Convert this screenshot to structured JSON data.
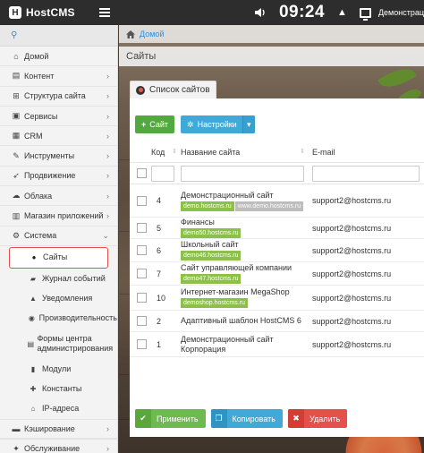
{
  "topbar": {
    "logo_mark": "H",
    "logo_text": "HostCMS",
    "clock": "09:24",
    "user_name": "Демонстрац"
  },
  "sidebar": {
    "items": [
      {
        "label": "Домой",
        "icon": "home-icon",
        "glyph": "⌂",
        "chevron": false
      },
      {
        "label": "Контент",
        "icon": "list-icon",
        "glyph": "▤",
        "chevron": true
      },
      {
        "label": "Структура сайта",
        "icon": "sitemap-icon",
        "glyph": "⊞",
        "chevron": true
      },
      {
        "label": "Сервисы",
        "icon": "briefcase-icon",
        "glyph": "▣",
        "chevron": true
      },
      {
        "label": "CRM",
        "icon": "crm-icon",
        "glyph": "▦",
        "chevron": true
      },
      {
        "label": "Инструменты",
        "icon": "tools-icon",
        "glyph": "✎",
        "chevron": true
      },
      {
        "label": "Продвижение",
        "icon": "rocket-icon",
        "glyph": "➶",
        "chevron": true
      },
      {
        "label": "Облака",
        "icon": "cloud-icon",
        "glyph": "☁",
        "chevron": true
      },
      {
        "label": "Магазин приложений",
        "icon": "store-icon",
        "glyph": "▥",
        "chevron": true
      },
      {
        "label": "Система",
        "icon": "gear-icon",
        "glyph": "⚙",
        "chevron": "down"
      }
    ],
    "sub_items": [
      {
        "label": "Сайты",
        "icon": "globe-icon",
        "glyph": "●",
        "active": true
      },
      {
        "label": "Журнал событий",
        "icon": "book-icon",
        "glyph": "▰"
      },
      {
        "label": "Уведомления",
        "icon": "bell-icon",
        "glyph": "▲"
      },
      {
        "label": "Производительность",
        "icon": "dashboard-icon",
        "glyph": "◉"
      },
      {
        "label": "Формы центра администрирования",
        "icon": "form-icon",
        "glyph": "▤",
        "tall": true
      },
      {
        "label": "Модули",
        "icon": "cube-icon",
        "glyph": "▮"
      },
      {
        "label": "Константы",
        "icon": "puzzle-icon",
        "glyph": "✚"
      },
      {
        "label": "IP-адреса",
        "icon": "ip-icon",
        "glyph": "⌂"
      }
    ],
    "bottom_items": [
      {
        "label": "Кэширование",
        "icon": "database-icon",
        "glyph": "▬",
        "chevron": true
      },
      {
        "label": "Обслуживание",
        "icon": "wrench-icon",
        "glyph": "✦",
        "chevron": true
      }
    ]
  },
  "main": {
    "breadcrumb": "Домой",
    "page_title": "Сайты",
    "panel_title": "Список сайтов",
    "toolbar": {
      "add_label": "Сайт",
      "settings_label": "Настройки"
    },
    "table": {
      "columns": [
        "Код",
        "Название сайта",
        "E-mail"
      ],
      "rows": [
        {
          "code": "4",
          "name": "Демонстрационный сайт",
          "domains": [
            "demo.hostcms.ru",
            "www.demo.hostcms.ru"
          ],
          "email": "support2@hostcms.ru"
        },
        {
          "code": "5",
          "name": "Финансы",
          "domains": [
            "demo50.hostcms.ru"
          ],
          "email": "support2@hostcms.ru"
        },
        {
          "code": "6",
          "name": "Школьный сайт",
          "domains": [
            "demo46.hostcms.ru"
          ],
          "email": "support2@hostcms.ru"
        },
        {
          "code": "7",
          "name": "Сайт управляющей компании",
          "domains": [
            "demo47.hostcms.ru"
          ],
          "email": "support2@hostcms.ru"
        },
        {
          "code": "10",
          "name": "Интернет-магазин MegaShop",
          "domains": [
            "demoshop.hostcms.ru"
          ],
          "email": "support2@hostcms.ru"
        },
        {
          "code": "2",
          "name": "Адаптивный шаблон HostCMS 6",
          "domains": [],
          "email": "support2@hostcms.ru"
        },
        {
          "code": "1",
          "name": "Демонстрационный сайт Корпорация",
          "domains": [],
          "email": "support2@hostcms.ru"
        }
      ]
    },
    "actions": {
      "apply_label": "Применить",
      "copy_label": "Копировать",
      "delete_label": "Удалить"
    }
  },
  "colors": {
    "accent_blue": "#2f8fd8",
    "green": "#53a93f",
    "red": "#e4504a",
    "domain_green": "#8cc04a"
  }
}
